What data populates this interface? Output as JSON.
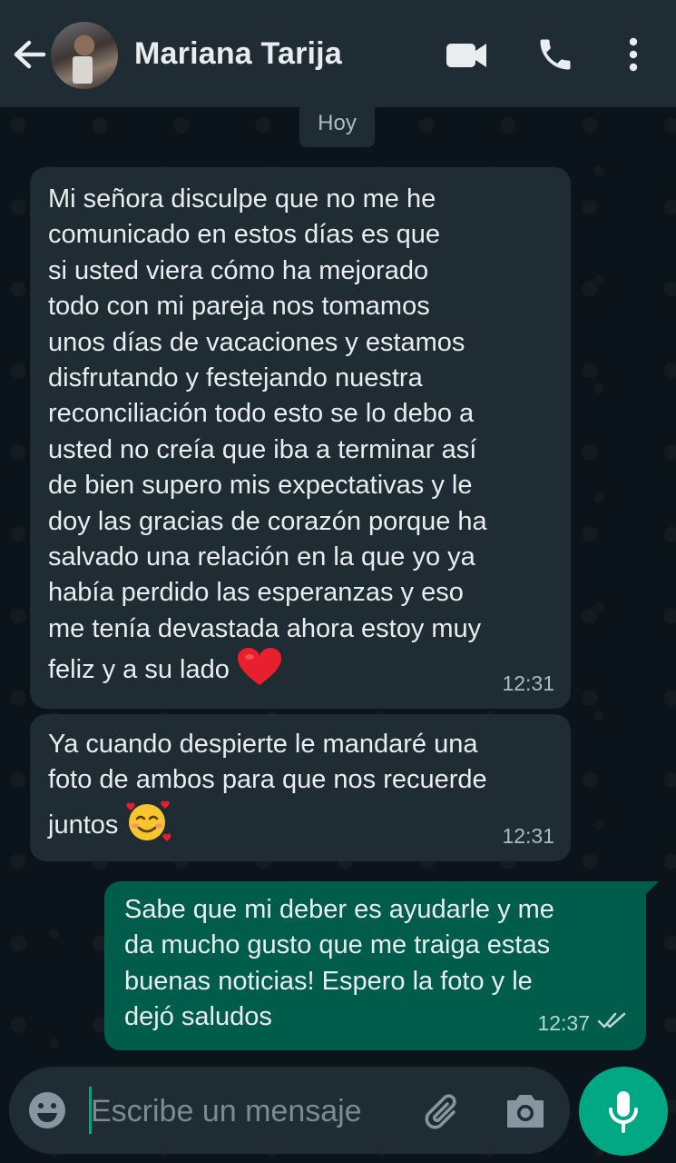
{
  "header": {
    "contact_name": "Mariana Tarija",
    "icons": [
      "back-arrow-icon",
      "video-call-icon",
      "phone-call-icon",
      "more-options-icon"
    ]
  },
  "chat": {
    "day_label": "Hoy",
    "messages": [
      {
        "direction": "incoming",
        "text": "Mi señora disculpe que no me he\ncomunicado en estos días es que\nsi usted viera cómo ha mejorado\ntodo con mi pareja nos tomamos\nunos días de vacaciones y estamos\ndisfrutando y festejando nuestra\nreconciliación todo esto se lo debo a\nusted no creía que iba a terminar así\nde bien supero mis expectativas y le\ndoy las gracias de corazón porque ha\nsalvado una relación en la que yo ya\nhabía perdido las esperanzas y eso\nme tenía devastada ahora estoy muy\nfeliz y a su lado",
        "emoji": "red-heart",
        "time": "12:31"
      },
      {
        "direction": "incoming",
        "text": "Ya cuando despierte le mandaré una\nfoto de ambos para que nos recuerde\njuntos",
        "emoji": "smiling-face-with-hearts",
        "time": "12:31"
      },
      {
        "direction": "outgoing",
        "text": "Sabe que mi deber es ayudarle y me\nda mucho gusto que me traiga estas\nbuenas noticias! Espero la foto y le\ndejó saludos",
        "time": "12:37",
        "status": "read"
      }
    ]
  },
  "composer": {
    "placeholder": "Escribe un mensaje",
    "icons": [
      "emoji-icon",
      "attach-icon",
      "camera-icon",
      "microphone-icon"
    ]
  },
  "colors": {
    "header_bg": "#1f2c34",
    "chat_bg": "#0b141a",
    "incoming_bubble": "#1f2c34",
    "outgoing_bubble": "#005c4b",
    "accent": "#00a884"
  }
}
